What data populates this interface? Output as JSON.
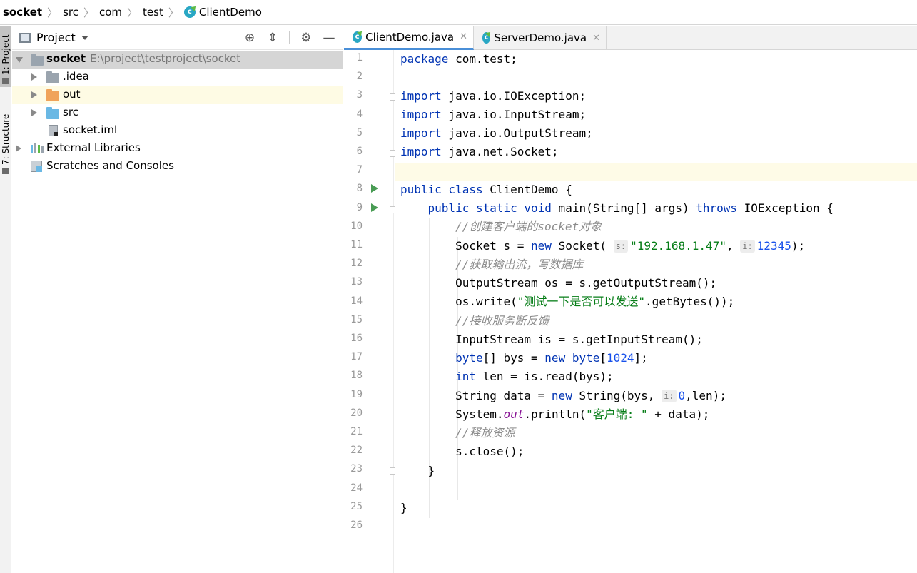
{
  "breadcrumb": [
    "socket",
    "src",
    "com",
    "test",
    "ClientDemo"
  ],
  "toolwindows": {
    "project": "1: Project",
    "structure": "7: Structure"
  },
  "project_pane": {
    "title": "Project",
    "tree": [
      {
        "label": "socket",
        "path": "E:\\project\\testproject\\socket"
      },
      {
        "label": ".idea"
      },
      {
        "label": "out"
      },
      {
        "label": "src"
      },
      {
        "label": "socket.iml"
      },
      {
        "label": "External Libraries"
      },
      {
        "label": "Scratches and Consoles"
      }
    ]
  },
  "tabs": [
    {
      "label": "ClientDemo.java",
      "active": true
    },
    {
      "label": "ServerDemo.java",
      "active": false
    }
  ],
  "editor": {
    "line_numbers": [
      "1",
      "2",
      "3",
      "4",
      "5",
      "6",
      "7",
      "8",
      "9",
      "10",
      "11",
      "12",
      "13",
      "14",
      "15",
      "16",
      "17",
      "18",
      "19",
      "20",
      "21",
      "22",
      "23",
      "24",
      "25",
      "26"
    ],
    "lines": [
      "package com.test;",
      "",
      "import java.io.IOException;",
      "import java.io.InputStream;",
      "import java.io.OutputStream;",
      "import java.net.Socket;",
      "",
      "public class ClientDemo {",
      "    public static void main(String[] args) throws IOException {",
      "        //创建客户端的socket对象",
      "        Socket s = new Socket( s: \"192.168.1.47\", i: 12345);",
      "        //获取输出流，写数据库",
      "        OutputStream os = s.getOutputStream();",
      "        os.write(\"测试一下是否可以发送\".getBytes());",
      "        //接收服务断反馈",
      "        InputStream is = s.getInputStream();",
      "        byte[] bys = new byte[1024];",
      "        int len = is.read(bys);",
      "        String data = new String(bys, i: 0,len);",
      "        System.out.println(\"客户端: \" + data);",
      "        //释放资源",
      "        s.close();",
      "    }",
      "",
      "}",
      ""
    ]
  },
  "colors": {
    "keyword": "#0033b3",
    "string": "#067d17",
    "number": "#1750eb",
    "comment": "#8c8c8c",
    "current_line": "#fefbe7",
    "selected_row": "#d5d5d5",
    "highlight_row": "#fefbe4"
  },
  "icons": [
    "class-icon",
    "folder-icon",
    "run-icon",
    "locate-icon",
    "collapse-icon",
    "gear-icon",
    "minimize-icon"
  ]
}
